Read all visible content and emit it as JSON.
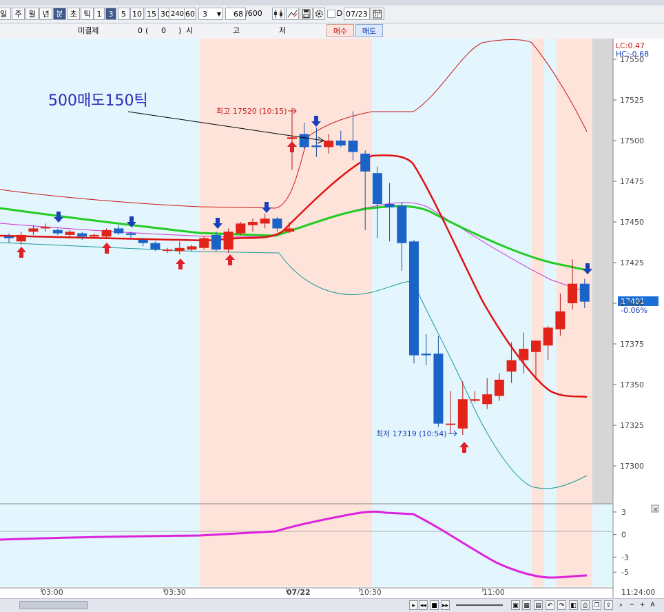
{
  "toolbar": {
    "periods": [
      "일",
      "주",
      "월",
      "년",
      "분",
      "초",
      "틱"
    ],
    "selected_period": "분",
    "intervals": [
      "1",
      "3",
      "5",
      "10",
      "15",
      "30",
      "240",
      "60"
    ],
    "selected_interval": "3",
    "interval_value": "3",
    "count": "68",
    "count_total": "/600",
    "date_check_label": "D",
    "date": "07/23"
  },
  "order_row": {
    "unsettled_label": "미결제",
    "unsettled_value": "0",
    "paren_open": "(",
    "paren_value": "0",
    "paren_close": ")",
    "market_label": "시",
    "high_label": "고",
    "low_label": "저",
    "buy_label": "매수",
    "sell_label": "매도"
  },
  "chart_data": {
    "type": "candlestick",
    "annotation": "500매도150틱",
    "high_label": "최고 17520 (10:15)",
    "low_label": "최저 17319 (10:54)",
    "lc_label": "LC:0.47",
    "hc_label": "HC:-0.68",
    "current_price": "17401",
    "current_change": "-0.06%",
    "y_ticks": [
      "17550",
      "17525",
      "17500",
      "17475",
      "17450",
      "17425",
      "17400",
      "17375",
      "17350",
      "17325",
      "17300"
    ],
    "y_tick_values": [
      17550,
      17525,
      17500,
      17475,
      17450,
      17425,
      17400,
      17375,
      17350,
      17325,
      17300
    ],
    "ylim": [
      17284,
      17557
    ],
    "x_ticks": [
      "03:00",
      "03:30",
      "07/22",
      "10:30",
      "11:00",
      "11:24:00"
    ],
    "candles": [
      {
        "o": 17441,
        "h": 17443,
        "l": 17437,
        "c": 17440
      },
      {
        "o": 17438,
        "h": 17444,
        "l": 17436,
        "c": 17442
      },
      {
        "o": 17444,
        "h": 17448,
        "l": 17442,
        "c": 17446
      },
      {
        "o": 17446,
        "h": 17449,
        "l": 17444,
        "c": 17447
      },
      {
        "o": 17445,
        "h": 17446,
        "l": 17442,
        "c": 17443
      },
      {
        "o": 17442,
        "h": 17445,
        "l": 17440,
        "c": 17444
      },
      {
        "o": 17443,
        "h": 17444,
        "l": 17439,
        "c": 17441
      },
      {
        "o": 17441,
        "h": 17443,
        "l": 17440,
        "c": 17442
      },
      {
        "o": 17441,
        "h": 17446,
        "l": 17440,
        "c": 17445
      },
      {
        "o": 17446,
        "h": 17448,
        "l": 17442,
        "c": 17443
      },
      {
        "o": 17443,
        "h": 17444,
        "l": 17440,
        "c": 17442
      },
      {
        "o": 17439,
        "h": 17440,
        "l": 17435,
        "c": 17437
      },
      {
        "o": 17437,
        "h": 17438,
        "l": 17432,
        "c": 17433
      },
      {
        "o": 17433,
        "h": 17434,
        "l": 17431,
        "c": 17433
      },
      {
        "o": 17432,
        "h": 17438,
        "l": 17430,
        "c": 17434
      },
      {
        "o": 17433,
        "h": 17436,
        "l": 17432,
        "c": 17435
      },
      {
        "o": 17434,
        "h": 17441,
        "l": 17433,
        "c": 17440
      },
      {
        "o": 17442,
        "h": 17444,
        "l": 17432,
        "c": 17433
      },
      {
        "o": 17433,
        "h": 17446,
        "l": 17431,
        "c": 17444
      },
      {
        "o": 17443,
        "h": 17450,
        "l": 17442,
        "c": 17449
      },
      {
        "o": 17448,
        "h": 17452,
        "l": 17444,
        "c": 17450
      },
      {
        "o": 17449,
        "h": 17455,
        "l": 17446,
        "c": 17452
      },
      {
        "o": 17452,
        "h": 17453,
        "l": 17444,
        "c": 17446
      },
      {
        "o": 17444,
        "h": 17450,
        "l": 17443,
        "c": 17446
      },
      {
        "o": 17501,
        "h": 17520,
        "l": 17482,
        "c": 17502
      },
      {
        "o": 17504,
        "h": 17511,
        "l": 17495,
        "c": 17496
      },
      {
        "o": 17497,
        "h": 17508,
        "l": 17490,
        "c": 17496
      },
      {
        "o": 17496,
        "h": 17504,
        "l": 17492,
        "c": 17500
      },
      {
        "o": 17500,
        "h": 17506,
        "l": 17496,
        "c": 17497
      },
      {
        "o": 17500,
        "h": 17518,
        "l": 17488,
        "c": 17493
      },
      {
        "o": 17492,
        "h": 17494,
        "l": 17445,
        "c": 17481
      },
      {
        "o": 17480,
        "h": 17484,
        "l": 17440,
        "c": 17461
      },
      {
        "o": 17461,
        "h": 17474,
        "l": 17438,
        "c": 17459
      },
      {
        "o": 17460,
        "h": 17462,
        "l": 17420,
        "c": 17437
      },
      {
        "o": 17438,
        "h": 17439,
        "l": 17363,
        "c": 17368
      },
      {
        "o": 17369,
        "h": 17381,
        "l": 17362,
        "c": 17368
      },
      {
        "o": 17369,
        "h": 17380,
        "l": 17324,
        "c": 17326
      },
      {
        "o": 17326,
        "h": 17346,
        "l": 17320,
        "c": 17326
      },
      {
        "o": 17323,
        "h": 17352,
        "l": 17319,
        "c": 17341
      },
      {
        "o": 17340,
        "h": 17346,
        "l": 17339,
        "c": 17341
      },
      {
        "o": 17338,
        "h": 17354,
        "l": 17335,
        "c": 17344
      },
      {
        "o": 17343,
        "h": 17357,
        "l": 17340,
        "c": 17353
      },
      {
        "o": 17358,
        "h": 17376,
        "l": 17351,
        "c": 17365
      },
      {
        "o": 17365,
        "h": 17382,
        "l": 17357,
        "c": 17372
      },
      {
        "o": 17370,
        "h": 17373,
        "l": 17353,
        "c": 17377
      },
      {
        "o": 17374,
        "h": 17386,
        "l": 17365,
        "c": 17385
      },
      {
        "o": 17384,
        "h": 17406,
        "l": 17380,
        "c": 17395
      },
      {
        "o": 17400,
        "h": 17427,
        "l": 17396,
        "c": 17412
      },
      {
        "o": 17412,
        "h": 17415,
        "l": 17397,
        "c": 17401
      }
    ],
    "macd": {
      "y_ticks": [
        "3",
        "0",
        "-3",
        "-5"
      ],
      "y_tick_values": [
        3,
        0,
        -3,
        -5
      ],
      "ylim": [
        -7,
        4
      ]
    }
  }
}
